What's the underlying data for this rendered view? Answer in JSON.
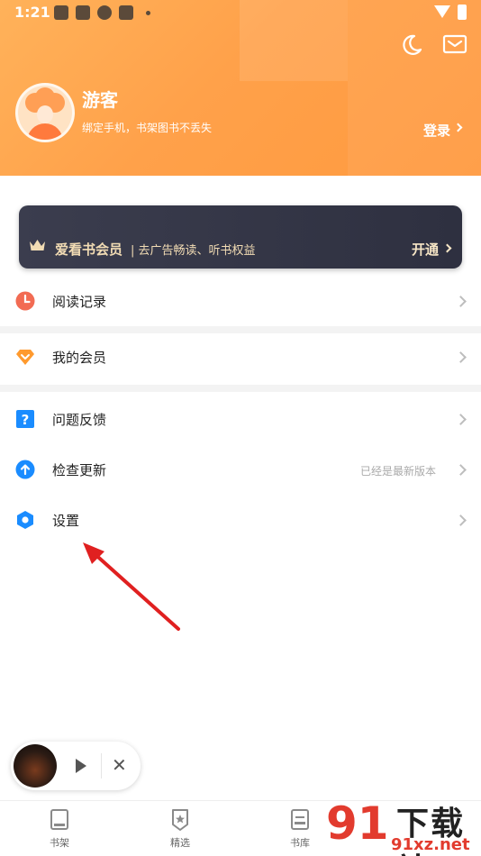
{
  "status_bar": {
    "time": "1:21"
  },
  "profile": {
    "name": "游客",
    "subtitle": "绑定手机，书架图书不丢失",
    "login_label": "登录"
  },
  "vip_banner": {
    "title": "爱看书会员",
    "subtitle": "| 去广告畅读、听书权益",
    "action_label": "开通",
    "text_color": "#f2dcb4"
  },
  "menu": {
    "reading_history": "阅读记录",
    "my_membership": "我的会员",
    "feedback": "问题反馈",
    "check_update": "检查更新",
    "check_update_hint": "已经是最新版本",
    "settings": "设置"
  },
  "tabs": {
    "bookshelf": "书架",
    "featured": "精选",
    "library": "书库"
  },
  "watermark": {
    "logo_digits": "91",
    "big_text": "下载站",
    "url": "91xz.net"
  },
  "colors": {
    "header_orange": "#ffa14a",
    "accent_red": "#e23b2e",
    "icon_blue": "#1a8cff"
  }
}
